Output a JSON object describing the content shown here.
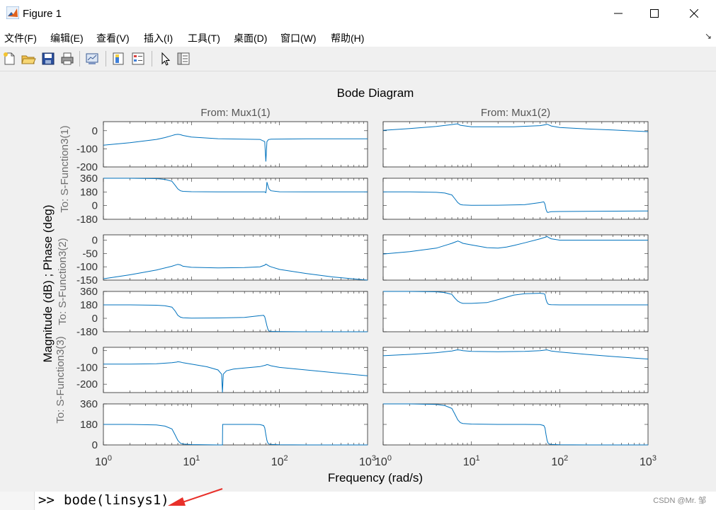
{
  "window": {
    "title": "Figure 1"
  },
  "menu": {
    "items": [
      "文件(F)",
      "编辑(E)",
      "查看(V)",
      "插入(I)",
      "工具(T)",
      "桌面(D)",
      "窗口(W)",
      "帮助(H)"
    ]
  },
  "toolbar": {
    "icons": [
      "new-figure-icon",
      "open-file-icon",
      "save-icon",
      "print-icon",
      "link-plot-icon",
      "insert-colorbar-icon",
      "insert-legend-icon",
      "pointer-icon",
      "property-inspector-icon"
    ]
  },
  "command": {
    "prompt": ">>",
    "text": "bode(linsys1)"
  },
  "watermark": "CSDN @Mr. 邹",
  "colors": {
    "line": "#0072bd",
    "axes_bg": "#ffffff",
    "figure_bg": "#f0f0f0",
    "arrow": "#e8302a"
  },
  "chart_data": {
    "type": "line",
    "title": "Bode Diagram",
    "xlabel": "Frequency  (rad/s)",
    "ylabel": "Magnitude (dB) ; Phase (deg)",
    "xscale": "log",
    "xlim": [
      1,
      1000
    ],
    "xtick_labels": [
      "10^0",
      "10^1",
      "10^2",
      "10^3"
    ],
    "grid": false,
    "columns": [
      "From: Mux1(1)",
      "From: Mux1(2)"
    ],
    "row_labels": [
      "To: S-Function3(1)",
      "To: S-Function3(2)",
      "To: S-Function3(3)"
    ],
    "rows": [
      {
        "kind": "magnitude",
        "ylim": [
          -200,
          50
        ],
        "ticks": [
          0,
          -100,
          -200
        ],
        "series": [
          {
            "x": [
              1,
              2,
              4,
              5,
              6,
              6.5,
              7,
              7.5,
              8,
              10,
              20,
              40,
              60,
              68,
              70,
              72,
              75,
              80,
              100,
              200,
              400,
              1000
            ],
            "y": [
              -80,
              -66,
              -48,
              -38,
              -27,
              -22,
              -20,
              -22,
              -26,
              -35,
              -44,
              -47,
              -48,
              -60,
              -170,
              -60,
              -49,
              -47,
              -46,
              -45,
              -45,
              -45
            ]
          },
          {
            "x": [
              1,
              2,
              4,
              6,
              6.8,
              7,
              7.5,
              10,
              30,
              60,
              70,
              72,
              75,
              80,
              100,
              200,
              400,
              1000
            ],
            "y": [
              2,
              12,
              24,
              34,
              38,
              37,
              30,
              22,
              22,
              28,
              34,
              36,
              32,
              26,
              18,
              10,
              4,
              -5
            ]
          }
        ]
      },
      {
        "kind": "phase",
        "ylim": [
          -180,
          360
        ],
        "ticks": [
          360,
          180,
          0,
          -180
        ],
        "series": [
          {
            "x": [
              1,
              2,
              4,
              5,
              6,
              6.5,
              7,
              7.5,
              8,
              10,
              20,
              40,
              68,
              70,
              71,
              72,
              74,
              76,
              80,
              100,
              200,
              1000
            ],
            "y": [
              360,
              360,
              355,
              345,
              320,
              270,
              220,
              195,
              188,
              183,
              180,
              180,
              180,
              170,
              220,
              310,
              260,
              220,
              195,
              182,
              180,
              180
            ]
          },
          {
            "x": [
              1,
              2,
              4,
              5,
              6,
              6.5,
              7,
              7.5,
              8,
              10,
              20,
              40,
              60,
              66,
              68,
              70,
              72,
              74,
              76,
              80,
              100,
              200,
              1000
            ],
            "y": [
              180,
              180,
              175,
              165,
              140,
              90,
              40,
              15,
              8,
              3,
              5,
              12,
              40,
              50,
              20,
              -50,
              -85,
              -90,
              -85,
              -80,
              -78,
              -75,
              -70
            ]
          }
        ]
      },
      {
        "kind": "magnitude",
        "ylim": [
          -150,
          20
        ],
        "ticks": [
          0,
          -50,
          -100,
          -150
        ],
        "series": [
          {
            "x": [
              1,
              2,
              4,
              6,
              6.8,
              7,
              7.5,
              8,
              10,
              20,
              40,
              60,
              68,
              70,
              72,
              75,
              80,
              100,
              200,
              400,
              1000
            ],
            "y": [
              -145,
              -130,
              -112,
              -98,
              -92,
              -91,
              -93,
              -98,
              -102,
              -104,
              -103,
              -100,
              -94,
              -90,
              -92,
              -96,
              -100,
              -110,
              -125,
              -138,
              -150
            ]
          },
          {
            "x": [
              1,
              2,
              4,
              6,
              6.8,
              7,
              7.5,
              8,
              10,
              15,
              20,
              25,
              30,
              40,
              60,
              70,
              72,
              75,
              80,
              100,
              200,
              1000
            ],
            "y": [
              -52,
              -43,
              -30,
              -12,
              -5,
              -3,
              -7,
              -12,
              -18,
              -28,
              -30,
              -26,
              -20,
              -10,
              5,
              12,
              14,
              10,
              5,
              0,
              0,
              0
            ]
          }
        ]
      },
      {
        "kind": "phase",
        "ylim": [
          -180,
          360
        ],
        "ticks": [
          360,
          180,
          0,
          -180
        ],
        "series": [
          {
            "x": [
              1,
              2,
              4,
              5,
              6,
              6.5,
              7,
              7.5,
              8,
              10,
              20,
              40,
              60,
              66,
              68,
              70,
              72,
              74,
              76,
              80,
              100,
              200,
              1000
            ],
            "y": [
              180,
              180,
              175,
              168,
              150,
              100,
              40,
              15,
              8,
              3,
              5,
              12,
              35,
              40,
              20,
              -40,
              -100,
              -150,
              -170,
              -175,
              -178,
              -180,
              -180
            ]
          },
          {
            "x": [
              1,
              2,
              4,
              5,
              6,
              6.5,
              7,
              7.5,
              8,
              10,
              15,
              20,
              30,
              40,
              60,
              66,
              68,
              70,
              72,
              74,
              76,
              80,
              100,
              200,
              1000
            ],
            "y": [
              360,
              360,
              355,
              345,
              320,
              270,
              230,
              210,
              200,
              200,
              210,
              250,
              310,
              330,
              335,
              330,
              320,
              250,
              210,
              190,
              185,
              182,
              180,
              180,
              180
            ]
          }
        ]
      },
      {
        "kind": "magnitude",
        "ylim": [
          -250,
          20
        ],
        "ticks": [
          0,
          -100,
          -200
        ],
        "series": [
          {
            "x": [
              1,
              2,
              4,
              6,
              6.8,
              7,
              7.5,
              8,
              10,
              15,
              20,
              22,
              22.5,
              23,
              25,
              30,
              40,
              60,
              70,
              72,
              75,
              80,
              100,
              200,
              400,
              1000
            ],
            "y": [
              -80,
              -80,
              -78,
              -72,
              -68,
              -66,
              -68,
              -72,
              -80,
              -96,
              -115,
              -140,
              -250,
              -140,
              -120,
              -110,
              -103,
              -95,
              -86,
              -83,
              -85,
              -90,
              -100,
              -115,
              -130,
              -150
            ]
          },
          {
            "x": [
              1,
              2,
              4,
              6,
              6.8,
              7,
              7.5,
              8,
              10,
              20,
              40,
              60,
              70,
              72,
              75,
              80,
              100,
              200,
              400,
              1000
            ],
            "y": [
              -30,
              -22,
              -12,
              -2,
              4,
              5,
              3,
              0,
              -4,
              -6,
              -4,
              0,
              4,
              5,
              2,
              -2,
              -8,
              -22,
              -35,
              -50
            ]
          }
        ]
      },
      {
        "kind": "phase",
        "ylim": [
          0,
          360
        ],
        "ticks": [
          360,
          180,
          0
        ],
        "series": [
          {
            "x": [
              1,
              2,
              4,
              5,
              6,
              6.5,
              7,
              7.5,
              8,
              10,
              20,
              22.5,
              22.6,
              23,
              30,
              50,
              60,
              66,
              68,
              70,
              72,
              74,
              76,
              80,
              100,
              200,
              1000
            ],
            "y": [
              180,
              180,
              175,
              165,
              140,
              90,
              40,
              15,
              8,
              3,
              0,
              0,
              180,
              180,
              180,
              180,
              178,
              170,
              150,
              90,
              40,
              15,
              8,
              5,
              2,
              0,
              0
            ]
          },
          {
            "x": [
              1,
              2,
              4,
              5,
              6,
              6.5,
              7,
              7.5,
              8,
              10,
              20,
              40,
              60,
              66,
              68,
              70,
              72,
              74,
              76,
              80,
              100,
              200,
              1000
            ],
            "y": [
              360,
              360,
              355,
              345,
              320,
              270,
              220,
              195,
              188,
              183,
              180,
              180,
              178,
              170,
              150,
              90,
              40,
              15,
              8,
              5,
              2,
              0,
              0
            ]
          }
        ]
      }
    ]
  }
}
